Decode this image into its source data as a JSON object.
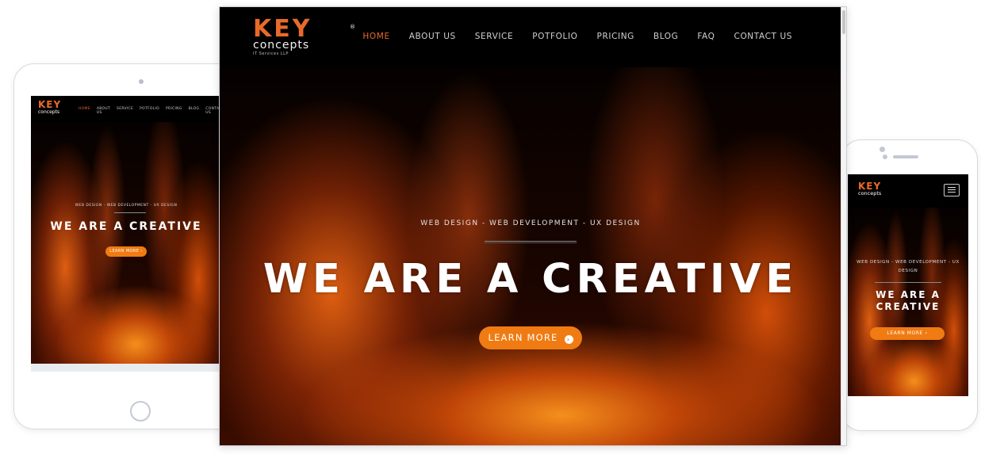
{
  "brand": {
    "logo_word": "KEY",
    "logo_sub": "concepts",
    "logo_tagline": "IT Services LLP",
    "logo_mark": "®"
  },
  "nav": {
    "items": [
      "HOME",
      "ABOUT US",
      "SERVICE",
      "POTFOLIO",
      "PRICING",
      "BLOG",
      "FAQ",
      "CONTACT US"
    ],
    "active": "HOME"
  },
  "hero": {
    "tagline": "WEB DESIGN - WEB DEVELOPMENT - UX DESIGN",
    "headline": "WE ARE A CREATIVE",
    "cta_label": "LEARN MORE",
    "cta_arrow": "›"
  },
  "colors": {
    "accent": "#f07b12",
    "logo_orange": "#e86a2a",
    "nav_bg": "#000000"
  },
  "icons": [
    "chevron-right-icon",
    "hamburger-menu-icon"
  ]
}
